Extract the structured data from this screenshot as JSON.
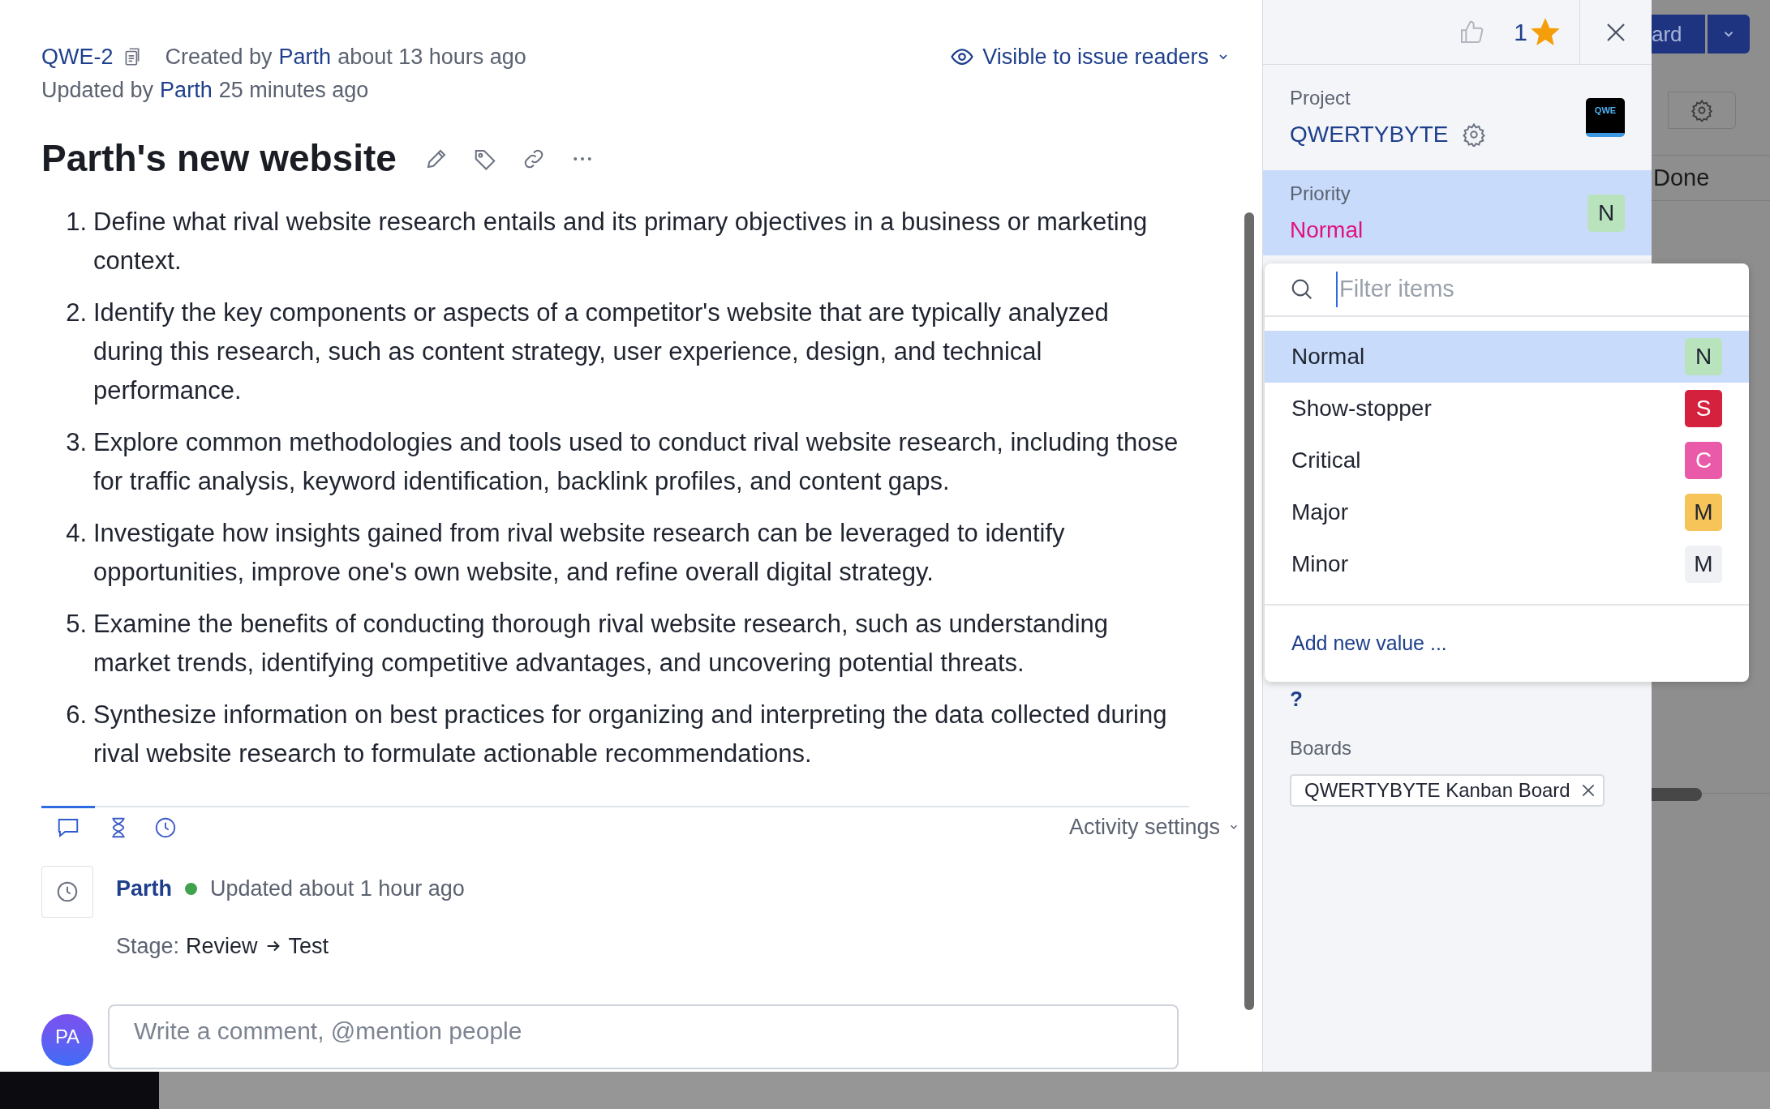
{
  "issue": {
    "id": "QWE-2",
    "created_prefix": "Created by",
    "created_author": "Parth",
    "created_time": "about 13 hours ago",
    "updated_prefix": "Updated by",
    "updated_author": "Parth",
    "updated_time": "25 minutes ago",
    "visibility": "Visible to issue readers",
    "title": "Parth's new website"
  },
  "description": [
    {
      "number": "1.",
      "text": "Define what rival website research entails and its primary objectives in a business or marketing context."
    },
    {
      "number": "2.",
      "text": "Identify the key components or aspects of a competitor's website that are typically analyzed during this research, such as content strategy, user experience, design, and technical performance."
    },
    {
      "number": "3.",
      "text": "Explore common methodologies and tools used to conduct rival website research, including those for traffic analysis, keyword identification, backlink profiles, and content gaps."
    },
    {
      "number": "4.",
      "text": "Investigate how insights gained from rival website research can be leveraged to identify opportunities, improve one's own website, and refine overall digital strategy."
    },
    {
      "number": "5.",
      "text": "Examine the benefits of conducting thorough rival website research, such as understanding market trends, identifying competitive advantages, and uncovering potential threats."
    },
    {
      "number": "6.",
      "text": "Synthesize information on best practices for organizing and interpreting the data collected during rival website research to formulate actionable recommendations."
    }
  ],
  "activity": {
    "tabs": [
      {
        "kind": "comments",
        "selected": true
      },
      {
        "kind": "work",
        "selected": false
      },
      {
        "kind": "history",
        "selected": false
      }
    ],
    "settings_label": "Activity settings",
    "entries": [
      {
        "author": "Parth",
        "online": true,
        "summary": "Updated about 1 hour ago",
        "field": "Stage:",
        "from": "Review",
        "to": "Test"
      }
    ],
    "comment": {
      "avatar": "PA",
      "placeholder": "Write a comment, @mention people"
    }
  },
  "panel": {
    "vote_count": "1",
    "starred": true,
    "project": {
      "label": "Project",
      "name": "QWERTYBYTE",
      "logo": "QWE"
    },
    "priority": {
      "label": "Priority",
      "value": "Normal",
      "badge": "N",
      "color": "#b9e3bd"
    },
    "hidden_value": "?",
    "boards": {
      "label": "Boards",
      "items": [
        "QWERTYBYTE Kanban Board"
      ]
    }
  },
  "priority_menu": {
    "placeholder": "Filter items",
    "options": [
      {
        "label": "Normal",
        "badge": "N",
        "color": "#b9e3bd",
        "selected": true
      },
      {
        "label": "Show-stopper",
        "badge": "S",
        "color": "#d4213d",
        "selected": false
      },
      {
        "label": "Critical",
        "badge": "C",
        "color": "#e95aa9",
        "selected": false
      },
      {
        "label": "Major",
        "badge": "M",
        "color": "#f7c45a",
        "selected": false
      },
      {
        "label": "Minor",
        "badge": "M",
        "color": "#f0f1f4",
        "selected": false
      }
    ],
    "add_label": "Add new value ..."
  },
  "background": {
    "button_text": "ard",
    "status": "Done"
  }
}
